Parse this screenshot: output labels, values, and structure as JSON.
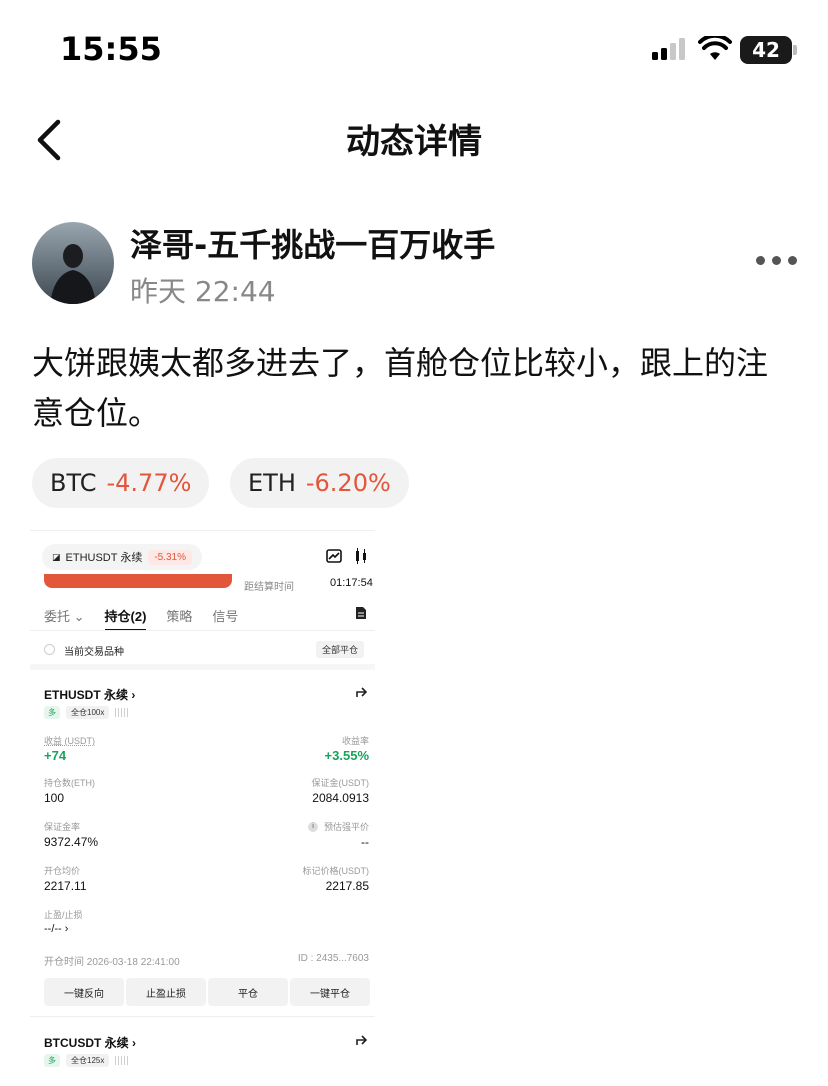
{
  "status_bar": {
    "time": "15:55",
    "battery": "42"
  },
  "nav": {
    "title": "动态详情"
  },
  "post": {
    "author": "泽哥-五千挑战一百万收手",
    "time": "昨天 22:44",
    "text": "大饼跟姨太都多进去了，首舱仓位比较小，跟上的注意仓位。",
    "tags": [
      {
        "symbol": "BTC",
        "change": "-4.77%"
      },
      {
        "symbol": "ETH",
        "change": "-6.20%"
      }
    ]
  },
  "screenshot": {
    "header_symbol": "ETHUSDT 永续",
    "header_change": "-5.31%",
    "settlement_label": "距结算时间",
    "settlement_time": "01:17:54",
    "tabs": [
      "委托 ⌄",
      "持仓(2)",
      "策略",
      "信号"
    ],
    "current_label": "当前交易品种",
    "close_all": "全部平仓",
    "position": {
      "symbol": "ETHUSDT 永续 ›",
      "side": "多",
      "leverage": "全仓100x",
      "pnl_label": "收益 (USDT)",
      "pnl_value": "+74",
      "roe_label": "收益率",
      "roe_value": "+3.55%",
      "qty_label": "持仓数(ETH)",
      "qty_value": "100",
      "margin_label": "保证金(USDT)",
      "margin_value": "2084.0913",
      "margin_rate_label": "保证金率",
      "margin_rate_value": "9372.47%",
      "liq_label": "预估强平价",
      "liq_value": "--",
      "entry_label": "开仓均价",
      "entry_value": "2217.11",
      "mark_label": "标记价格(USDT)",
      "mark_value": "2217.85",
      "tpsl_label": "止盈/止损",
      "tpsl_value": "--/-- ›",
      "open_time": "开仓时间 2026-03-18 22:41:00",
      "id": "ID : 2435...7603"
    },
    "buttons": [
      "一键反向",
      "止盈止损",
      "平仓",
      "一键平仓"
    ],
    "position2": {
      "symbol": "BTCUSDT 永续 ›",
      "side": "多",
      "leverage": "全仓125x"
    }
  },
  "icons": [
    "back-icon",
    "more-icon",
    "share-icon",
    "chart-icon",
    "doc-icon"
  ]
}
